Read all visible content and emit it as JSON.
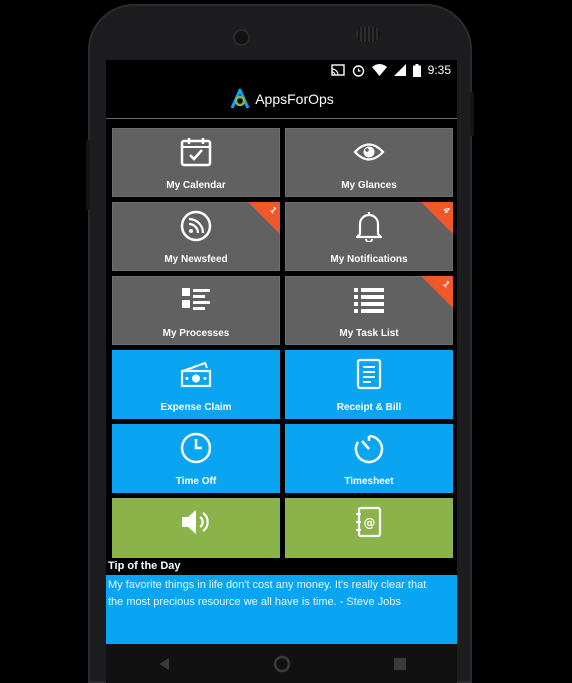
{
  "status": {
    "time": "9:35"
  },
  "app": {
    "title": "AppsForOps",
    "accent": "#0aa5f2"
  },
  "tiles": [
    {
      "label": "My Calendar",
      "icon": "calendar-check-icon",
      "color": "gray"
    },
    {
      "label": "My Glances",
      "icon": "eye-icon",
      "color": "gray"
    },
    {
      "label": "My Newsfeed",
      "icon": "rss-icon",
      "color": "gray",
      "badge": "1"
    },
    {
      "label": "My Notifications",
      "icon": "bell-icon",
      "color": "gray",
      "badge": "4"
    },
    {
      "label": "My Processes",
      "icon": "process-list-icon",
      "color": "gray"
    },
    {
      "label": "My Task List",
      "icon": "task-list-icon",
      "color": "gray",
      "badge": "1"
    },
    {
      "label": "Expense Claim",
      "icon": "cash-icon",
      "color": "blue"
    },
    {
      "label": "Receipt & Bill",
      "icon": "receipt-icon",
      "color": "blue"
    },
    {
      "label": "Time Off",
      "icon": "clock-icon",
      "color": "blue"
    },
    {
      "label": "Timesheet",
      "icon": "stopwatch-icon",
      "color": "blue"
    },
    {
      "label": "",
      "icon": "speaker-icon",
      "color": "green"
    },
    {
      "label": "",
      "icon": "address-book-icon",
      "color": "green"
    }
  ],
  "tip": {
    "heading": "Tip of the Day",
    "text": "My favorite things in life don't cost any money. It's really clear that\nthe most precious resource we all have is time. - Steve Jobs"
  },
  "colors": {
    "tile_gray": "#616161",
    "tile_blue": "#0aa5f2",
    "tile_green": "#8ab34a",
    "badge": "#f0582a"
  }
}
